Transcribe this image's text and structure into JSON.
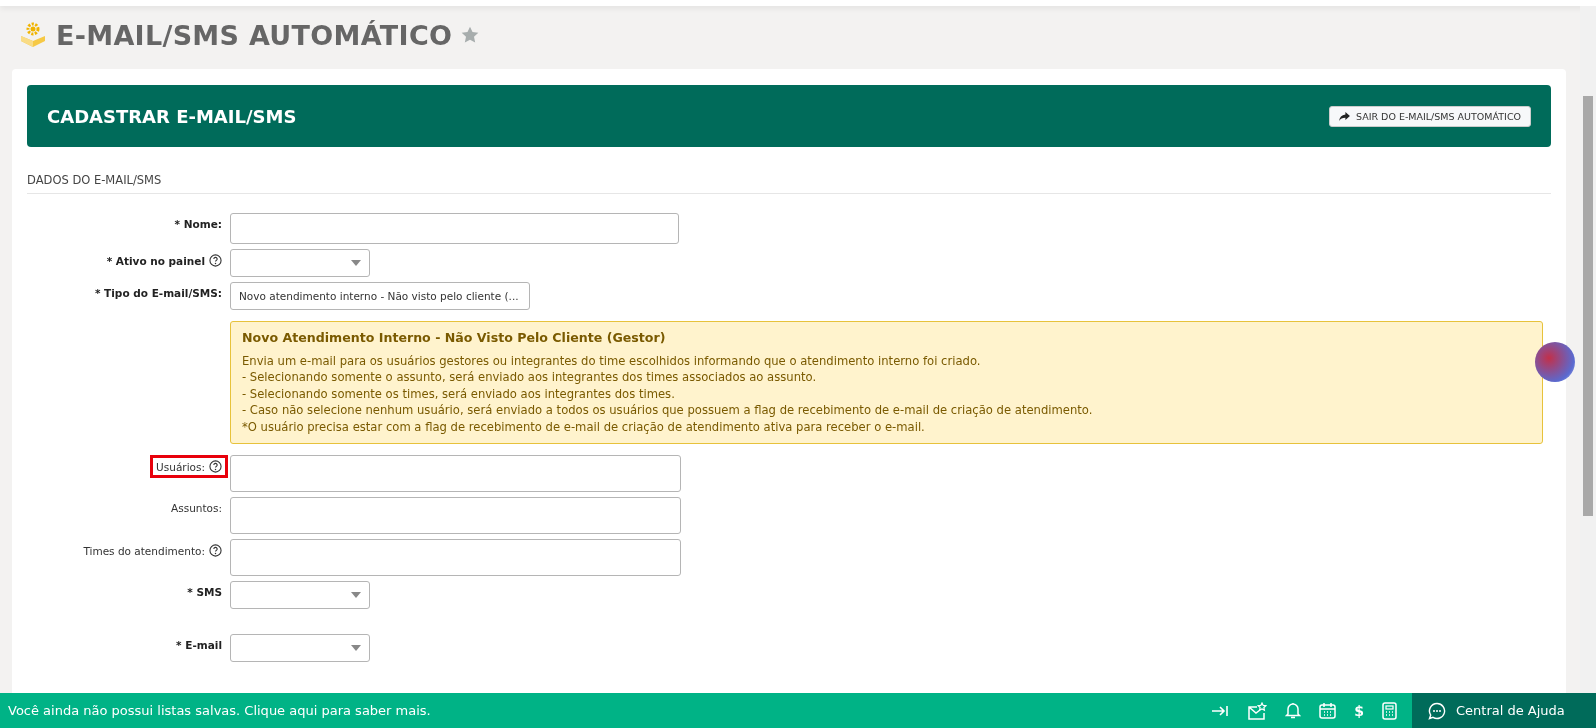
{
  "page": {
    "title": "E-MAIL/SMS AUTOMÁTICO",
    "favorite": false
  },
  "panel": {
    "title": "CADASTRAR E-MAIL/SMS",
    "exit_button": "SAIR DO E-MAIL/SMS AUTOMÁTICO"
  },
  "section": {
    "title": "DADOS DO E-MAIL/SMS"
  },
  "fields": [
    {
      "kind": "text",
      "label": "* Nome:",
      "required": true,
      "help": false,
      "highlighted": false
    },
    {
      "kind": "select",
      "label": "* Ativo no painel",
      "required": true,
      "help": true,
      "highlighted": false
    },
    {
      "kind": "select",
      "label": "* Tipo do E-mail/SMS:",
      "required": true,
      "help": false,
      "highlighted": false,
      "value": "Novo atendimento interno - Não visto pelo cliente (..."
    },
    {
      "kind": "info",
      "title": "Novo Atendimento Interno - Não Visto Pelo Cliente (Gestor)",
      "lines": [
        "Envia um e-mail para os usuários gestores ou integrantes do time escolhidos informando que o atendimento interno foi criado.",
        "- Selecionando somente o assunto, será enviado aos integrantes dos times associados ao assunto.",
        "- Selecionando somente os times, será enviado aos integrantes dos times.",
        "- Caso não selecione nenhum usuário, será enviado a todos os usuários que possuem a flag de recebimento de e-mail de criação de atendimento.",
        "*O usuário precisa estar com a flag de recebimento de e-mail de criação de atendimento ativa para receber o e-mail."
      ]
    },
    {
      "kind": "multi",
      "label": "Usuários:",
      "required": false,
      "help": true,
      "highlighted": true
    },
    {
      "kind": "multi",
      "label": "Assuntos:",
      "required": false,
      "help": false,
      "highlighted": false
    },
    {
      "kind": "multi",
      "label": "Times do atendimento:",
      "required": false,
      "help": true,
      "highlighted": false
    },
    {
      "kind": "select",
      "label": "* SMS",
      "required": true,
      "help": false,
      "highlighted": false
    },
    {
      "kind": "select",
      "label": "* E-mail",
      "required": true,
      "help": false,
      "highlighted": false
    }
  ],
  "footer": {
    "message": "Você ainda não possui listas salvas. Clique aqui para saber mais.",
    "currency_symbol": "$",
    "help_button": "Central de Ajuda"
  }
}
